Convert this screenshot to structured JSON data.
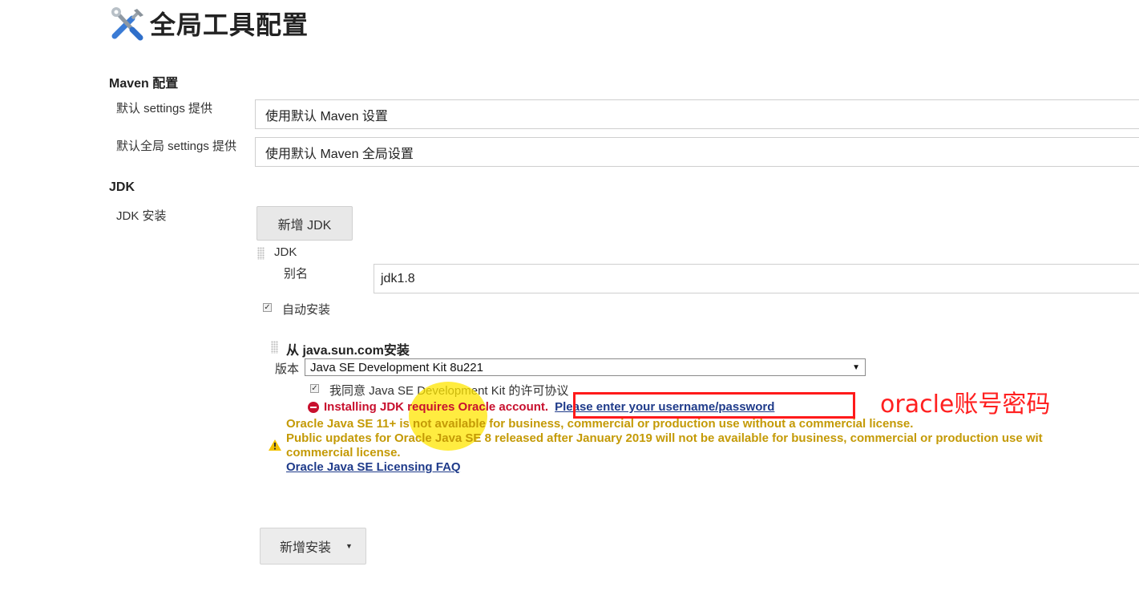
{
  "page": {
    "title": "全局工具配置",
    "title_icon": "tools-icon"
  },
  "maven": {
    "section_title": "Maven 配置",
    "settings_label": "默认 settings 提供",
    "settings_value": "使用默认 Maven 设置",
    "global_settings_label": "默认全局 settings 提供",
    "global_settings_value": "使用默认 Maven 全局设置"
  },
  "jdk": {
    "section_title": "JDK",
    "install_label": "JDK 安装",
    "add_button": "新增 JDK",
    "item_title": "JDK",
    "alias_label": "别名",
    "alias_value": "jdk1.8",
    "auto_install_label": "自动安装",
    "auto_install_checked": true,
    "installer": {
      "title": "从 java.sun.com安装",
      "version_label": "版本",
      "version_value": "Java SE Development Kit 8u221",
      "license_label": "我同意 Java SE Development Kit 的许可协议",
      "license_checked": true,
      "error_text": "Installing JDK requires Oracle account.",
      "credentials_link": "Please enter your username/password",
      "warning_line1": "Oracle Java SE 11+ is not available for business, commercial or production use without a commercial license.",
      "warning_line2": "Public updates for Oracle Java SE 8 released after January 2019 will not be available for business, commercial or production use wit",
      "warning_line3": "commercial license.",
      "faq_link": "Oracle Java SE Licensing FAQ"
    },
    "add_install_button": "新增安装",
    "dropdown_icon": "caret-down-icon"
  },
  "annotation": {
    "text": "oracle账号密码",
    "color": "#ff1a1a"
  },
  "colors": {
    "error": "#c8102e",
    "warning": "#c49a06",
    "link": "#1f3b8a"
  }
}
